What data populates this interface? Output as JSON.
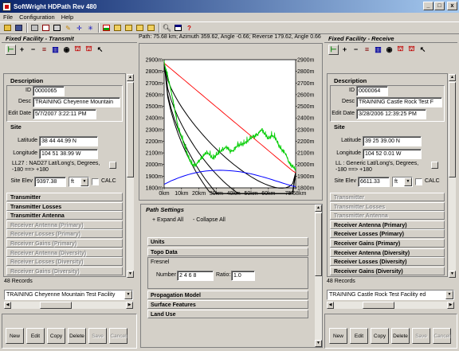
{
  "window": {
    "title": "SoftWright HDPath Rev 480",
    "controls": [
      "_",
      "□",
      "x"
    ]
  },
  "menu": [
    "File",
    "Configuration",
    "Help"
  ],
  "toolbar_icons": [
    "open-icon",
    "save-icon",
    "print-icon",
    "checklist-icon",
    "calc-icon",
    "edit-icon",
    "crosshair-icon",
    "star-icon",
    "terrain-icon",
    "folder-icon",
    "folder2-icon",
    "folder3-icon",
    "folder4-icon",
    "zoom-icon",
    "window-icon",
    "help-icon"
  ],
  "path_info": "Path: 75.68 km; Azimuth 359.62, Angle -0.66; Reverse 179.62, Angle 0.66",
  "transmit": {
    "header": "Fixed Facility - Transmit",
    "description_label": "Description",
    "id_label": "ID",
    "id": "0000065",
    "desc_label": "Desc",
    "desc": "TRAINING Cheyenne Mountain",
    "edit_date_label": "Edit Date",
    "edit_date": "5/7/2007 3:22:11 PM",
    "site_label": "Site",
    "lat_label": "Latitude",
    "lat": "38 44 44.99 N",
    "lon_label": "Longitude",
    "lon": "104 51 38.99 W",
    "datum": "LL27 : NAD27 Lat/Long's, Degrees, -180 ==> +180",
    "elev_label": "Site Elev",
    "elev": "9397.38",
    "unit": "ft",
    "calc": "CALC",
    "sections": [
      {
        "label": "Transmitter",
        "enabled": true
      },
      {
        "label": "Transmitter Losses",
        "enabled": true
      },
      {
        "label": "Transmitter Antenna",
        "enabled": true
      },
      {
        "label": "Receiver Antenna (Primary)",
        "enabled": false
      },
      {
        "label": "Receiver Losses (Primary)",
        "enabled": false
      },
      {
        "label": "Receiver Gains (Primary)",
        "enabled": false
      },
      {
        "label": "Receiver Antenna (Diversity)",
        "enabled": false
      },
      {
        "label": "Receiver Losses (Diversity)",
        "enabled": false
      },
      {
        "label": "Receiver Gains (Diversity)",
        "enabled": false
      }
    ],
    "records": "48 Records",
    "selected": "TRAINING Cheyenne Mountain Test Facility",
    "buttons": [
      {
        "label": "New",
        "enabled": true
      },
      {
        "label": "Edit",
        "enabled": true
      },
      {
        "label": "Copy",
        "enabled": true
      },
      {
        "label": "Delete",
        "enabled": true
      },
      {
        "label": "Save",
        "enabled": false
      },
      {
        "label": "Cancel",
        "enabled": false
      }
    ]
  },
  "receive": {
    "header": "Fixed Facility - Receive",
    "description_label": "Description",
    "id_label": "ID",
    "id": "0000064",
    "desc_label": "Desc",
    "desc": "TRAINING Castle Rock Test F",
    "edit_date_label": "Edit Date",
    "edit_date": "3/28/2006 12:39:25 PM",
    "site_label": "Site",
    "lat_label": "Latitude",
    "lat": "39 25 39.00 N",
    "lon_label": "Longitude",
    "lon": "104 52 0.01 W",
    "datum": "LL : Generic Lat/Long's, Degrees, -180 ==> +180",
    "elev_label": "Site Elev",
    "elev": "6611.33",
    "unit": "ft",
    "calc": "CALC",
    "sections": [
      {
        "label": "Transmitter",
        "enabled": false
      },
      {
        "label": "Transmitter Losses",
        "enabled": false
      },
      {
        "label": "Transmitter Antenna",
        "enabled": false
      },
      {
        "label": "Receiver Antenna (Primary)",
        "enabled": true
      },
      {
        "label": "Receiver Losses (Primary)",
        "enabled": true
      },
      {
        "label": "Receiver Gains (Primary)",
        "enabled": true
      },
      {
        "label": "Receiver Antenna (Diversity)",
        "enabled": true
      },
      {
        "label": "Receiver Losses (Diversity)",
        "enabled": true
      },
      {
        "label": "Receiver Gains (Diversity)",
        "enabled": true
      }
    ],
    "records": "48 Records",
    "selected": "TRAINING Castle Rock Test Facility ed",
    "buttons": [
      {
        "label": "New",
        "enabled": true
      },
      {
        "label": "Edit",
        "enabled": true
      },
      {
        "label": "Copy",
        "enabled": true
      },
      {
        "label": "Delete",
        "enabled": true
      },
      {
        "label": "Save",
        "enabled": false
      },
      {
        "label": "Cancel",
        "enabled": false
      }
    ]
  },
  "path_settings": {
    "title": "Path Settings",
    "expand": "+ Expand All",
    "collapse": "- Collapse All",
    "units": "Units",
    "topo": "Topo Data",
    "fresnel": "Fresnel",
    "number_label": "Number",
    "number": "2 4 6 8",
    "ratio_label": "Ratio:",
    "ratio": "1.0",
    "propagation": "Propagation Model",
    "surface": "Surface Features",
    "landuse": "Land Use"
  },
  "colors": {
    "terrain": "#00cc00",
    "los": "#ff0000",
    "earth": "#0000ff",
    "fresnel": "#000000"
  },
  "chart_data": {
    "type": "line",
    "x": [
      0,
      2,
      4,
      6,
      8,
      10,
      12,
      14,
      16,
      18,
      20,
      22,
      24,
      26,
      28,
      30,
      32,
      34,
      36,
      38,
      40,
      42,
      44,
      46,
      48,
      50,
      52,
      54,
      56,
      58,
      60,
      62,
      64,
      66,
      68,
      70,
      72,
      74,
      75.68
    ],
    "x_ticks": [
      "0km",
      "10km",
      "20km",
      "30km",
      "40km",
      "50km",
      "60km",
      "75.68km"
    ],
    "y_ticks": [
      "1800m",
      "1900m",
      "2000m",
      "2100m",
      "2200m",
      "2300m",
      "2400m",
      "2500m",
      "2600m",
      "2700m",
      "2800m",
      "2900m"
    ],
    "ylim": [
      1800,
      2900
    ],
    "xlim": [
      0,
      75.68
    ],
    "series": [
      {
        "values": [
          2870,
          2760,
          2630,
          2480,
          2320,
          2240,
          2150,
          2060,
          2000,
          1990,
          2030,
          2060,
          2100,
          2090,
          2050,
          2080,
          2110,
          2130,
          2150,
          2110,
          2120,
          2160,
          2170,
          2180,
          2200,
          2230,
          2240,
          2260,
          2300,
          2260,
          2220,
          2250,
          2230,
          2160,
          2120,
          2090,
          2010,
          1980,
          1960
        ]
      },
      {
        "values": [
          2870,
          2845,
          2820,
          2795,
          2770,
          2745,
          2720,
          2695,
          2670,
          2645,
          2620,
          2595,
          2570,
          2545,
          2520,
          2495,
          2470,
          2445,
          2420,
          2395,
          2370,
          2345,
          2320,
          2295,
          2270,
          2245,
          2220,
          2195,
          2170,
          2145,
          2120,
          2095,
          2070,
          2045,
          2020,
          1995,
          1970,
          1945,
          1930
        ]
      },
      {
        "values": [
          1830,
          1845,
          1860,
          1872,
          1884,
          1895,
          1905,
          1914,
          1922,
          1929,
          1935,
          1940,
          1944,
          1947,
          1949,
          1950,
          1951,
          1950,
          1949,
          1947,
          1944,
          1941,
          1937,
          1932,
          1926,
          1920,
          1913,
          1905,
          1897,
          1889,
          1880,
          1871,
          1861,
          1852,
          1842,
          1833,
          1823,
          1815,
          1810
        ]
      }
    ]
  }
}
